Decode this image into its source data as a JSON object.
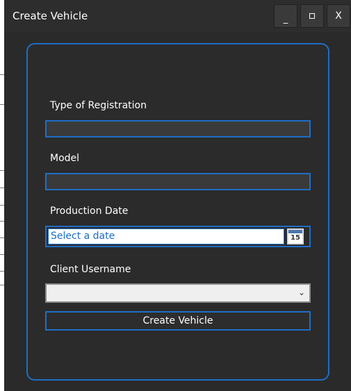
{
  "window": {
    "title": "Create Vehicle",
    "minimize_label": "_",
    "close_label": "X"
  },
  "form": {
    "registration": {
      "label": "Type of Registration",
      "value": ""
    },
    "model": {
      "label": "Model",
      "value": ""
    },
    "production_date": {
      "label": "Production Date",
      "placeholder": "Select a date",
      "calendar_day": "15"
    },
    "client_username": {
      "label": "Client Username",
      "selected": ""
    },
    "submit_label": "Create Vehicle"
  },
  "colors": {
    "accent": "#1e6ec8",
    "background": "#2a2a2a"
  }
}
